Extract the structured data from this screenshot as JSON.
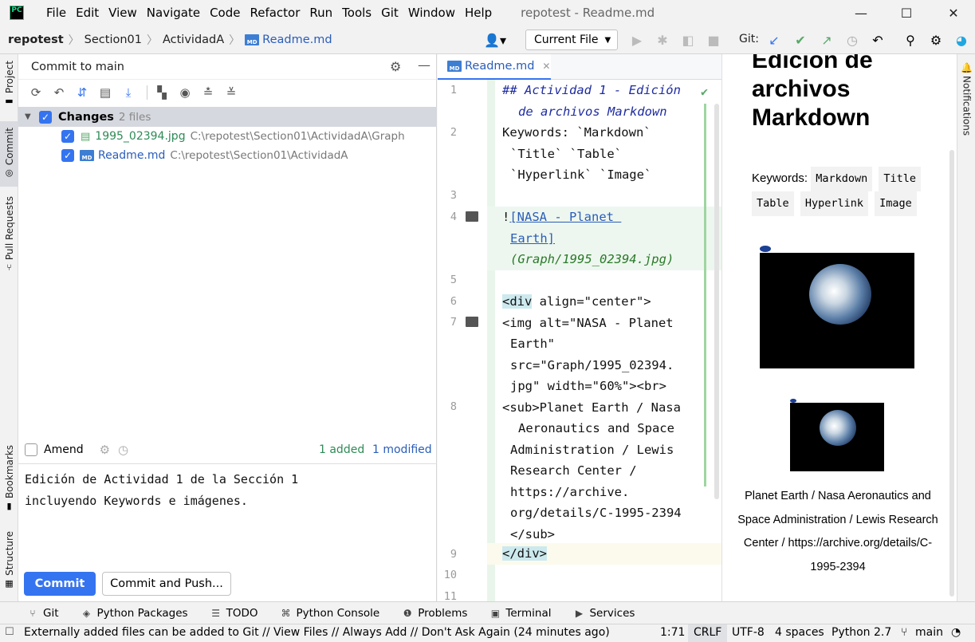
{
  "window": {
    "title": "repotest - Readme.md",
    "menu": [
      "File",
      "Edit",
      "View",
      "Navigate",
      "Code",
      "Refactor",
      "Run",
      "Tools",
      "Git",
      "Window",
      "Help"
    ],
    "logo_text": "PC"
  },
  "navbar": {
    "breadcrumbs": [
      "repotest",
      "Section01",
      "ActividadA",
      "Readme.md"
    ],
    "run_config": "Current File",
    "git_label": "Git:"
  },
  "left_strip": {
    "tabs": [
      "Project",
      "Commit",
      "Pull Requests",
      "Bookmarks",
      "Structure"
    ]
  },
  "commit_panel": {
    "header": "Commit to main",
    "changes_label": "Changes",
    "changes_count": "2 files",
    "files": [
      {
        "name": "1995_02394.jpg",
        "path": "C:\\repotest\\Section01\\ActividadA\\Graph"
      },
      {
        "name": "Readme.md",
        "path": "C:\\repotest\\Section01\\ActividadA"
      }
    ],
    "amend_label": "Amend",
    "added": "1 added",
    "modified": "1 modified",
    "message_lines": [
      "Edición de Actividad 1 de la Sección 1",
      "incluyendo Keywords e imágenes."
    ],
    "commit_button": "Commit",
    "commit_push_button": "Commit and Push..."
  },
  "editor": {
    "tab_label": "Readme.md",
    "line_numbers": [
      "1",
      "2",
      "3",
      "4",
      "5",
      "6",
      "7",
      "8",
      "9",
      "10",
      "11"
    ]
  },
  "preview": {
    "title_lines": [
      "Edición de",
      "archivos",
      "Markdown"
    ],
    "keywords_label": "Keywords:",
    "keywords": [
      "Markdown",
      "Title",
      "Table",
      "Hyperlink",
      "Image"
    ],
    "caption": "Planet Earth / Nasa Aeronautics and Space Administration / Lewis Research Center / https://archive.org/details/C-1995-2394"
  },
  "right_strip": {
    "tab": "Notifications"
  },
  "bottom_tools": [
    "Git",
    "Python Packages",
    "TODO",
    "Python Console",
    "Problems",
    "Terminal",
    "Services"
  ],
  "status": {
    "message": "Externally added files can be added to Git // View Files // Always Add // Don't Ask Again (24 minutes ago)",
    "position": "1:71",
    "line_sep": "CRLF",
    "encoding": "UTF-8",
    "indent": "4 spaces",
    "interpreter": "Python 2.7",
    "branch": "main"
  },
  "colors": {
    "accent": "#3574f0",
    "link": "#2a5dba",
    "added_file": "#2e8b57",
    "git_green": "#59a869"
  }
}
